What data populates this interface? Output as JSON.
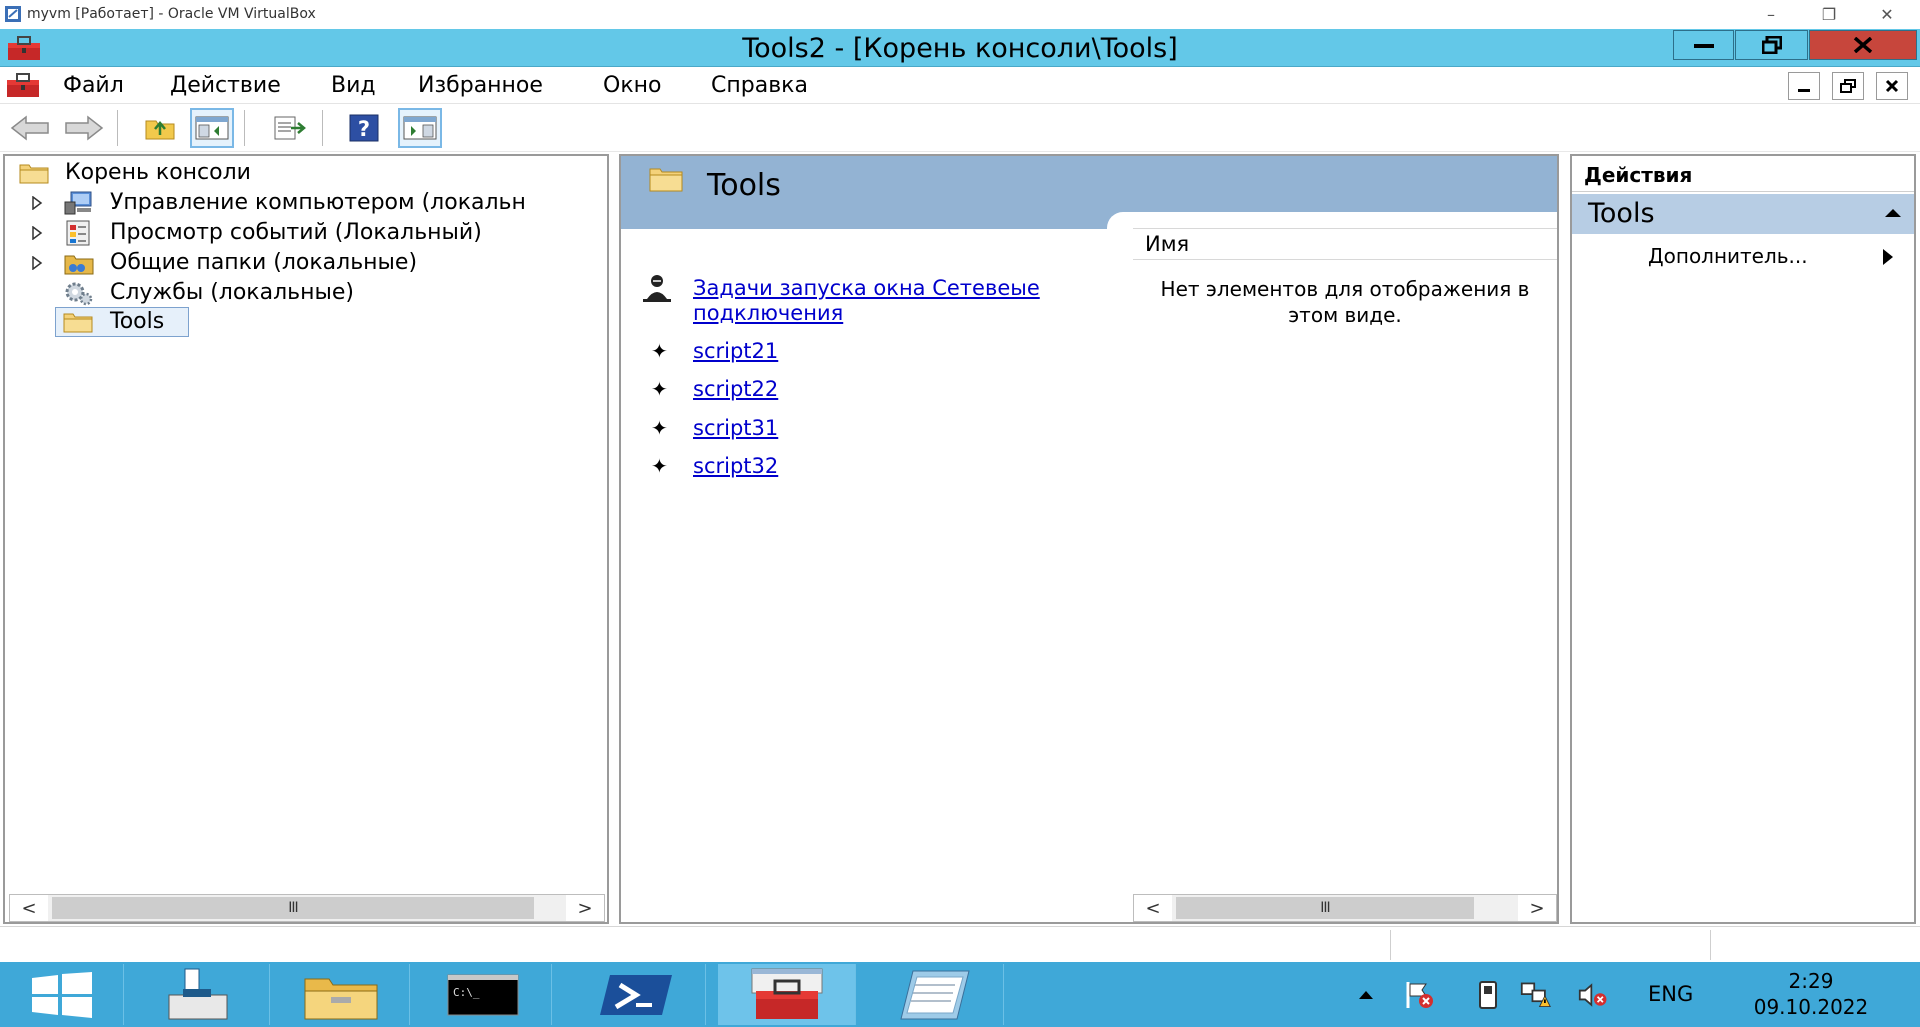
{
  "host_window": {
    "title": "myvm [Работает] - Oracle VM VirtualBox"
  },
  "mmc_window": {
    "title": "Tools2 - [Корень консоли\\Tools]"
  },
  "menu": {
    "items": [
      "Файл",
      "Действие",
      "Вид",
      "Избранное",
      "Окно",
      "Справка"
    ]
  },
  "tree": {
    "root": "Корень консоли",
    "items": [
      {
        "label": "Управление компьютером (локальн",
        "expandable": true,
        "icon": "computer-management-icon"
      },
      {
        "label": "Просмотр событий (Локальный)",
        "expandable": true,
        "icon": "event-viewer-icon"
      },
      {
        "label": "Общие папки (локальные)",
        "expandable": true,
        "icon": "shared-folders-icon"
      },
      {
        "label": "Службы (локальные)",
        "expandable": false,
        "icon": "services-icon"
      },
      {
        "label": "Tools",
        "expandable": false,
        "icon": "folder-icon",
        "selected": true
      }
    ]
  },
  "center": {
    "header_title": "Tools",
    "tasks": [
      "Задачи запуска окна Сетевеые подключения",
      "script21",
      "script22",
      "script31",
      "script32"
    ],
    "list_column": "Имя",
    "empty_message": "Нет элементов для отображения в этом виде."
  },
  "actions": {
    "title": "Действия",
    "section": "Tools",
    "more": "Дополнитель..."
  },
  "scroll": {
    "thumb_glyph": "III",
    "left": "<",
    "right": ">"
  },
  "taskbar": {
    "language": "ENG",
    "time": "2:29",
    "date": "09.10.2022",
    "accent_color": "#3fa8d8"
  },
  "colors": {
    "mmc_title_bar": "#63c8e8",
    "taskpad_header": "#93b3d3",
    "actions_section": "#b7cde4",
    "link": "#0000cc"
  }
}
